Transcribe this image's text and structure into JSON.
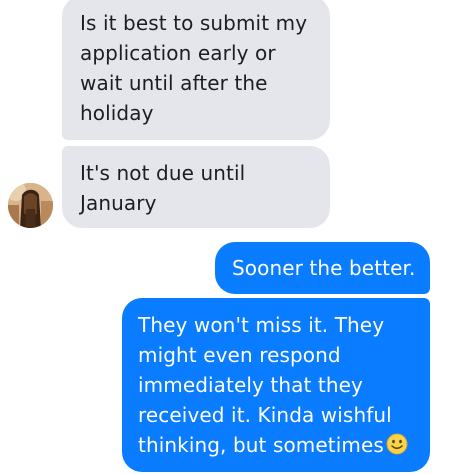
{
  "conversation": {
    "incoming": [
      {
        "text": "Is it best to submit my\napplication early or\nwait until after the\nholiday"
      },
      {
        "text": "It's not due until\nJanuary"
      }
    ],
    "outgoing": [
      {
        "text": "Sooner the better."
      },
      {
        "text": "They won't miss it. They\nmight even respond\nimmediately that they\nreceived it. Kinda wishful\nthinking, but sometimes",
        "emoji": "slightly-smiling-face-icon"
      }
    ]
  },
  "contact": {
    "avatar": "contact-avatar"
  },
  "colors": {
    "incoming_bubble": "#e4e6eb",
    "incoming_text": "#1c1e21",
    "outgoing_bubble": "#0a7cff",
    "outgoing_text": "#ffffff"
  }
}
